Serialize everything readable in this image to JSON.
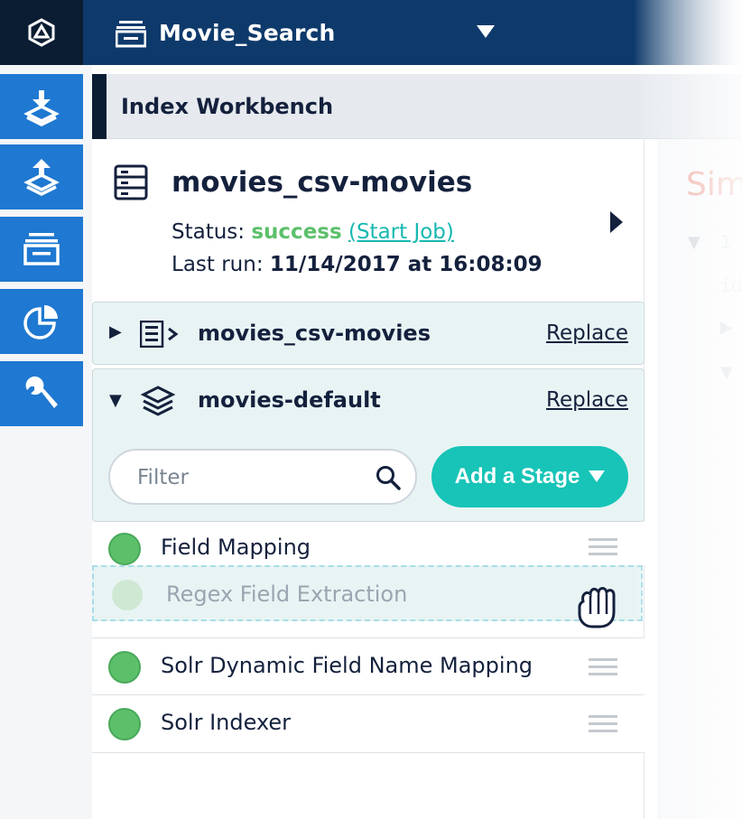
{
  "topbar": {
    "app_name": "Movie_Search",
    "icons": [
      "platform-logo-icon",
      "app-stack-icon",
      "caret-down-icon"
    ]
  },
  "sidebar": {
    "items": [
      {
        "name": "index-icon"
      },
      {
        "name": "query-icon"
      },
      {
        "name": "collections-icon"
      },
      {
        "name": "analytics-icon"
      },
      {
        "name": "system-icon"
      }
    ]
  },
  "workbench": {
    "title": "Index Workbench"
  },
  "datasource": {
    "name": "movies_csv-movies",
    "status_label": "Status: ",
    "status_value": "success",
    "start_job": "(Start Job)",
    "last_run_label": "Last run: ",
    "last_run_value": "11/14/2017 at 16:08:09"
  },
  "sections": {
    "parser": {
      "title": "movies_csv-movies",
      "replace": "Replace"
    },
    "pipeline": {
      "title": "movies-default",
      "replace": "Replace",
      "filter_placeholder": "Filter",
      "add_stage": "Add a Stage"
    }
  },
  "stages": [
    {
      "label": "Field Mapping",
      "status": "success"
    },
    {
      "label": "Regex Field Extraction",
      "status": "success",
      "dragging": true
    },
    {
      "label": "Solr Dynamic Field Name Mapping",
      "status": "success"
    },
    {
      "label": "Solr Indexer",
      "status": "success"
    }
  ],
  "right_panel": {
    "partial_title": "Sim",
    "line_number": "1",
    "partial_key": "id"
  },
  "colors": {
    "topbar": "#0e3a6b",
    "sidebar_button": "#1f78d1",
    "success": "#5cc06b",
    "accent": "#17c4b7",
    "link": "#17b8b1"
  }
}
